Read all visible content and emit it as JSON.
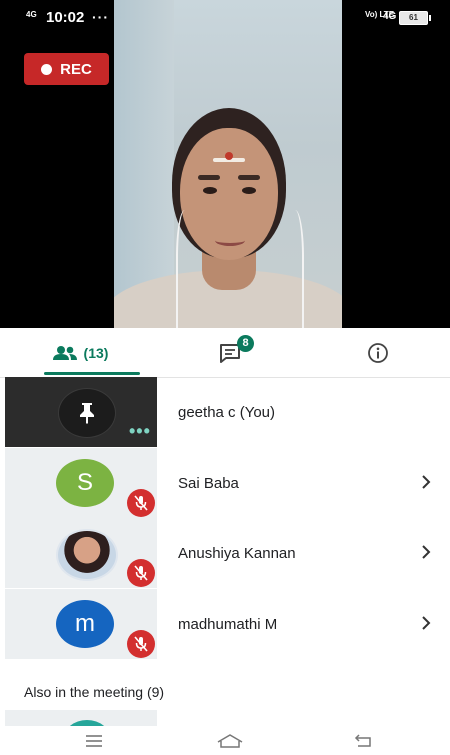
{
  "status": {
    "network_left": "4G",
    "time": "10:02",
    "dots": "···",
    "volte": "Vo) LTE",
    "network_right": "4G",
    "battery": "61"
  },
  "recording": {
    "label": "REC"
  },
  "tabs": {
    "people_count": "(13)",
    "chat_badge": "8"
  },
  "participants": [
    {
      "name": "geetha c (You)",
      "avatar": "pin-icon",
      "muted": false
    },
    {
      "name": "Sai Baba",
      "avatar_letter": "S",
      "muted": true
    },
    {
      "name": "Anushiya Kannan",
      "avatar": "photo",
      "muted": true
    },
    {
      "name": "madhumathi M",
      "avatar_letter": "m",
      "muted": true
    }
  ],
  "also_in_meeting": "Also in the meeting (9)",
  "colors": {
    "accent": "#0b7a5d",
    "rec": "#c62828",
    "mute": "#d32f2f",
    "avatar_s": "#7cb342",
    "avatar_m": "#1565c0"
  }
}
